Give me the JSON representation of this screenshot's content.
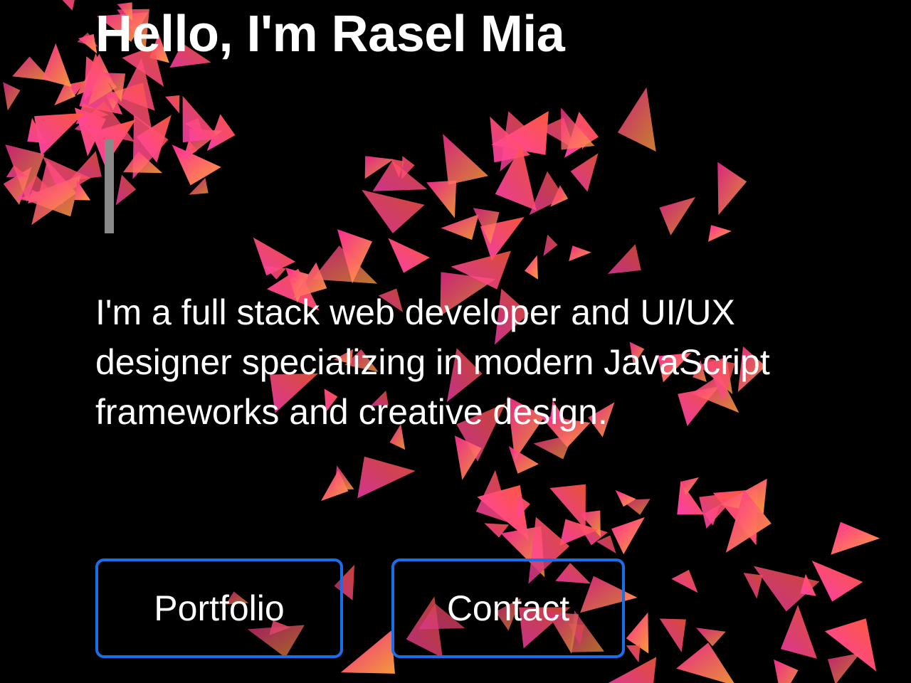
{
  "hero": {
    "title": "Hello, I'm Rasel Mia",
    "description": "I'm a full stack web developer and UI/UX designer specializing in modern JavaScript frameworks and creative design.",
    "buttons": [
      {
        "label": "Portfolio"
      },
      {
        "label": "Contact"
      }
    ]
  },
  "colors": {
    "background": "#000000",
    "text": "#ffffff",
    "button_border": "#1a6fe8",
    "cursor": "#8a8a8a",
    "particle_start": "#ff2d95",
    "particle_end": "#ffa23a"
  }
}
